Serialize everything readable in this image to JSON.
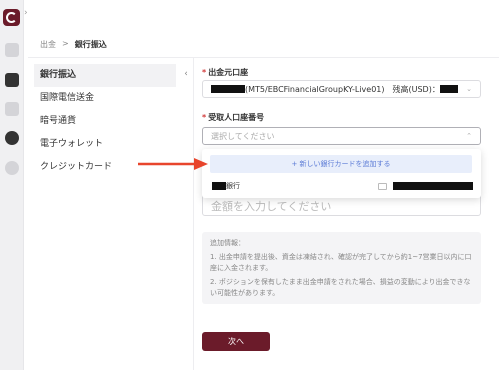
{
  "breadcrumb": {
    "parent": "出金",
    "sep": ">",
    "current": "銀行振込"
  },
  "side_menu": {
    "collapse_icon": "chevron-left-icon",
    "items": [
      {
        "label": "銀行振込"
      },
      {
        "label": "国際電信送金"
      },
      {
        "label": "暗号通貨"
      },
      {
        "label": "電子ウォレット"
      },
      {
        "label": "クレジットカード"
      }
    ]
  },
  "form": {
    "source_label": "出金元口座",
    "source_value": "(MT5/EBCFinancialGroupKY-Live01)",
    "balance_label": "残高(USD)：",
    "dest_label": "受取人口座番号",
    "dest_placeholder": "選択してください",
    "add_card": "+ 新しい銀行カードを追加する",
    "bank_suffix": "銀行",
    "amount_placeholder": "金額を入力してください",
    "info_title": "追加情報：",
    "info_1": "1. 出金申請を提出後、資金は凍結され、確認が完了してから約1~7営業日以内に口座に入金されます。",
    "info_2": "2. ポジションを保有したまま出金申請をされた場合、損益の変動により出金できない可能性があります。",
    "next": "次へ"
  },
  "icons": {
    "arrow_color": "#e8452c",
    "brand_color": "#6b1b2a"
  }
}
